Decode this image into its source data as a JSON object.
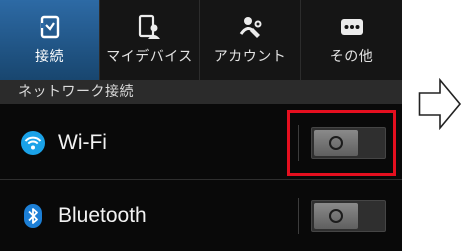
{
  "tabs": [
    {
      "label": "接続",
      "icon": "connections-icon",
      "active": true
    },
    {
      "label": "マイデバイス",
      "icon": "my-device-icon",
      "active": false
    },
    {
      "label": "アカウント",
      "icon": "accounts-icon",
      "active": false
    },
    {
      "label": "その他",
      "icon": "more-icon",
      "active": false
    }
  ],
  "section": {
    "header": "ネットワーク接続"
  },
  "rows": {
    "wifi": {
      "label": "Wi-Fi",
      "icon": "wifi-icon",
      "toggle_on": false
    },
    "bluetooth": {
      "label": "Bluetooth",
      "icon": "bluetooth-icon",
      "toggle_on": false
    }
  },
  "colors": {
    "active_tab": "#2d6aa5",
    "highlight": "#e50f1f",
    "wifi_icon": "#1aa2e8",
    "bluetooth_icon": "#1c7fd6"
  },
  "annotation": {
    "icon": "right-arrow-icon"
  }
}
